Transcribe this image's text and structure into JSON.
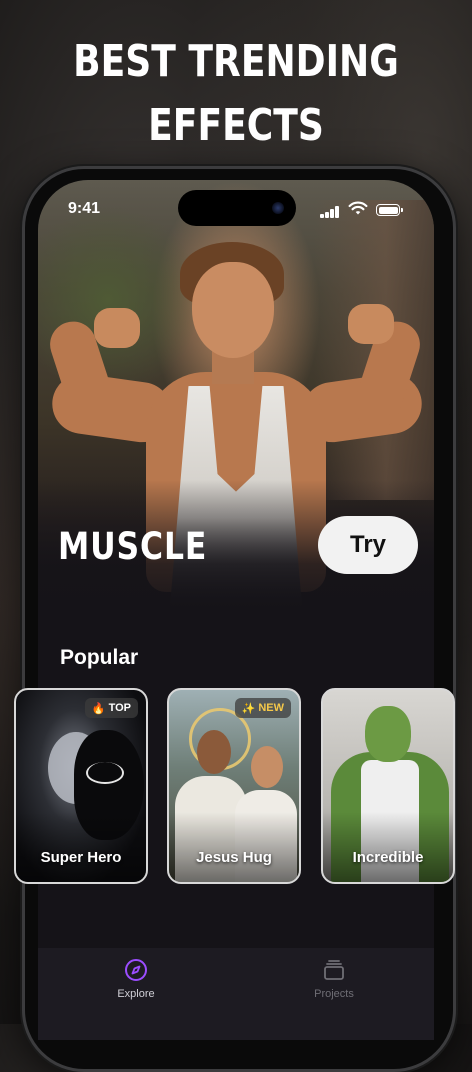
{
  "headline": {
    "line1": "BEST TRENDING",
    "line2": "EFFECTS"
  },
  "status_bar": {
    "time": "9:41"
  },
  "hero": {
    "effect_name": "MUSCLE",
    "try_label": "Try"
  },
  "popular": {
    "title": "Popular",
    "cards": [
      {
        "label": "Super Hero",
        "badge": "TOP",
        "badge_icon": "fire-icon"
      },
      {
        "label": "Jesus Hug",
        "badge": "NEW",
        "badge_icon": "sparkle-icon"
      },
      {
        "label": "Incredible"
      }
    ]
  },
  "tab_bar": {
    "items": [
      {
        "label": "Explore",
        "icon": "compass-icon",
        "active": true
      },
      {
        "label": "Projects",
        "icon": "stack-icon",
        "active": false
      }
    ]
  },
  "colors": {
    "accent": "#9b4dff",
    "background": "#151318",
    "button": "#f2f2f2",
    "new_badge": "#f5c84a"
  }
}
